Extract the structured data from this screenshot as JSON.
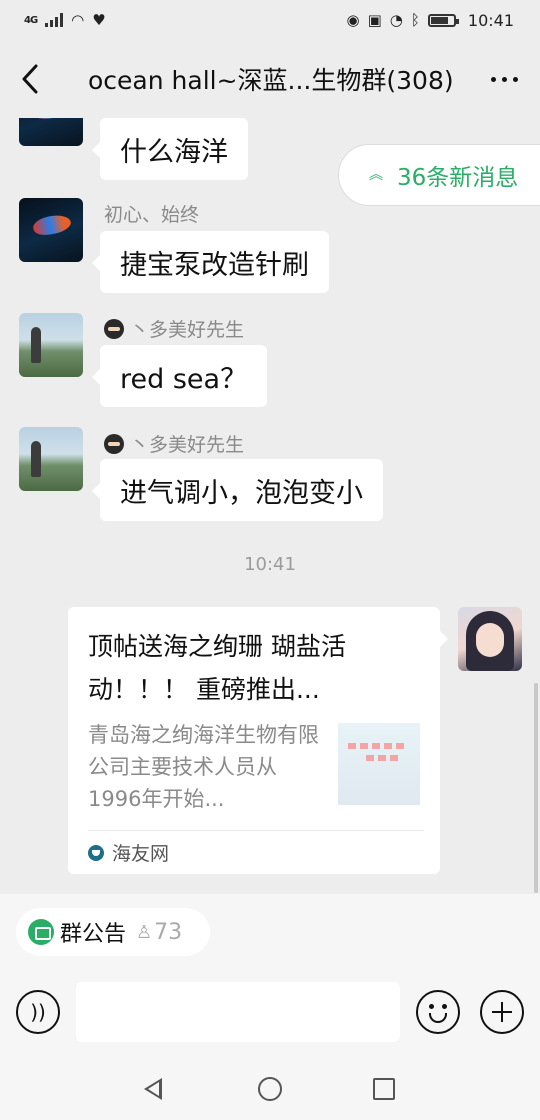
{
  "status_bar": {
    "network": "4G",
    "time": "10:41"
  },
  "header": {
    "title": "ocean hall~深蓝...生物群(308)"
  },
  "new_messages": {
    "label": "36条新消息"
  },
  "messages": [
    {
      "sender": "",
      "text": "什么海洋"
    },
    {
      "sender": "初心、始终",
      "text": "捷宝泵改造针刷"
    },
    {
      "sender": "丶多美好先生",
      "text": "red sea？"
    },
    {
      "sender": "丶多美好先生",
      "text": "进气调小，泡泡变小"
    }
  ],
  "timestamp": "10:41",
  "shared_card": {
    "title": "顶帖送海之绚珊 瑚盐活动！！！ 重磅推出...",
    "description": "青岛海之绚海洋生物有限公司主要技术人员从1996年开始...",
    "source": "海友网"
  },
  "group_notice": {
    "label": "群公告",
    "count": "73"
  },
  "colors": {
    "accent": "#2aae67",
    "background": "#ededed",
    "bubble": "#ffffff"
  }
}
